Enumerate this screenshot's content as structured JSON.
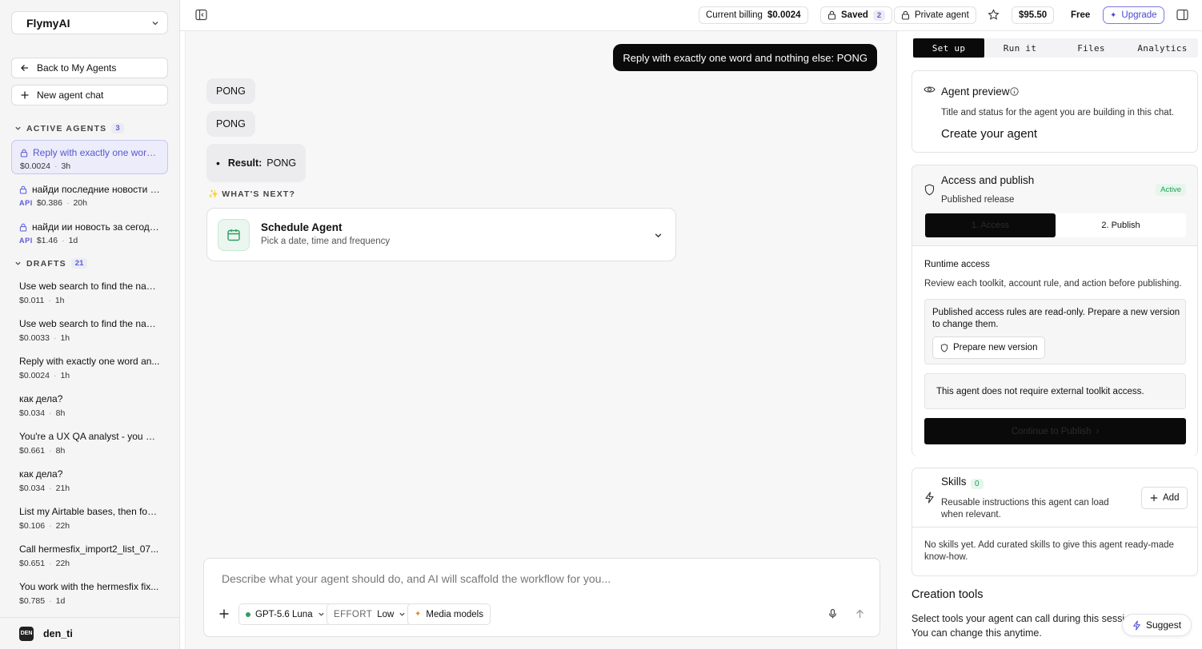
{
  "sidebar": {
    "workspace": "FlymyAI",
    "back_label": "Back to My Agents",
    "new_chat_label": "New agent chat",
    "active_section": {
      "label": "ACTIVE AGENTS",
      "count": "3"
    },
    "active_agents": [
      {
        "title": "Reply with exactly one word ...",
        "api": "",
        "cost": "$0.0024",
        "time": "3h"
      },
      {
        "title": "найди последние новости з...",
        "api": "API",
        "cost": "$0.386",
        "time": "20h"
      },
      {
        "title": "найди ии новость за сегодн...",
        "api": "API",
        "cost": "$1.46",
        "time": "1d"
      }
    ],
    "drafts_section": {
      "label": "DRAFTS",
      "count": "21"
    },
    "drafts": [
      {
        "title": "Use web search to find the nam...",
        "cost": "$0.011",
        "time": "1h"
      },
      {
        "title": "Use web search to find the nam...",
        "cost": "$0.0033",
        "time": "1h"
      },
      {
        "title": "Reply with exactly one word an...",
        "cost": "$0.0024",
        "time": "1h"
      },
      {
        "title": "как дела?",
        "cost": "$0.034",
        "time": "8h"
      },
      {
        "title": "You're a UX QA analyst - you ac...",
        "cost": "$0.661",
        "time": "8h"
      },
      {
        "title": "как дела?",
        "cost": "$0.034",
        "time": "21h"
      },
      {
        "title": "List my Airtable bases, then for ...",
        "cost": "$0.106",
        "time": "22h"
      },
      {
        "title": "Call hermesfix_import2_list_07...",
        "cost": "$0.651",
        "time": "22h"
      },
      {
        "title": "You work with the hermesfix fix...",
        "cost": "$0.785",
        "time": "1d"
      }
    ],
    "user": {
      "name": "den_ti",
      "avatar_text": "DEN"
    }
  },
  "topbar": {
    "billing_label": "Current billing",
    "billing_value": "$0.0024",
    "saved_label": "Saved",
    "saved_count": "2",
    "private_label": "Private agent",
    "balance": "$95.50",
    "plan": "Free",
    "upgrade_label": "Upgrade"
  },
  "chat": {
    "user_message": "Reply with exactly one word and nothing else: PONG",
    "replies": [
      "PONG",
      "PONG"
    ],
    "result_label": "Result:",
    "result_value": "PONG",
    "whats_next": "WHAT'S NEXT?",
    "schedule": {
      "title": "Schedule Agent",
      "subtitle": "Pick a date, time and frequency"
    },
    "composer": {
      "placeholder": "Describe what your agent should do, and AI will scaffold the workflow for you...",
      "model": "GPT-5.6 Luna",
      "effort_label": "EFFORT",
      "effort_value": "Low",
      "media_label": "Media models"
    }
  },
  "right_panel": {
    "tabs": [
      "Set up",
      "Run it",
      "Files",
      "Analytics"
    ],
    "preview": {
      "title": "Agent preview",
      "desc": "Title and status for the agent you are building in this chat.",
      "name": "Create your agent"
    },
    "access": {
      "title": "Access and publish",
      "subtitle": "Published release",
      "status": "Active",
      "steps": [
        "1. Access",
        "2. Publish"
      ],
      "runtime_title": "Runtime access",
      "runtime_desc": "Review each toolkit, account rule, and action before publishing.",
      "readonly_note": "Published access rules are read-only. Prepare a new version to change them.",
      "prepare_label": "Prepare new version",
      "no_toolkit": "This agent does not require external toolkit access.",
      "continue_label": "Continue to Publish"
    },
    "skills": {
      "title": "Skills",
      "count": "0",
      "desc": "Reusable instructions this agent can load when relevant.",
      "add_label": "Add",
      "empty": "No skills yet. Add curated skills to give this agent ready-made know-how."
    },
    "creation": {
      "title": "Creation tools",
      "desc": "Select tools your agent can call during this session. You can change this anytime.",
      "suggest_label": "Suggest"
    }
  },
  "colors": {
    "accent": "#5a5ad8",
    "active_green": "#1f9d55",
    "dark": "#0a0a0a"
  }
}
